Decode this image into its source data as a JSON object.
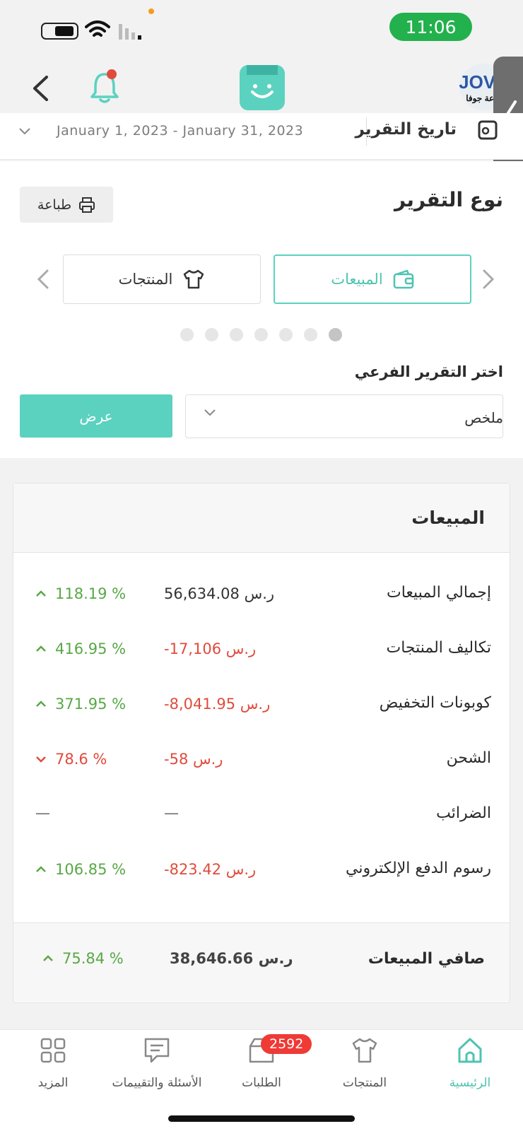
{
  "status": {
    "time": "11:06"
  },
  "brand": {
    "name": "JOVA",
    "sub": "مزرعة جوفا"
  },
  "report_date": {
    "label": "تاريخ التقرير",
    "range": "January 1, 2023 - January 31, 2023"
  },
  "report_type": {
    "title": "نوع التقرير",
    "print_label": "طباعة",
    "tiles": [
      {
        "label": "المبيعات",
        "icon": "wallet-icon",
        "selected": true
      },
      {
        "label": "المنتجات",
        "icon": "tshirt-icon",
        "selected": false
      }
    ],
    "page_dots": 7,
    "active_dot": 6
  },
  "sub_report": {
    "label": "اختر التقرير الفرعي",
    "selected": "ملخص",
    "button": "عرض"
  },
  "sales": {
    "title": "المبيعات",
    "rows": [
      {
        "label": "إجمالي المبيعات",
        "value": "56,634.08 ر.س",
        "value_tone": "neutral",
        "pct": "118.19 %",
        "trend": "up"
      },
      {
        "label": "تكاليف المنتجات",
        "value": "-17,106 ر.س",
        "value_tone": "neg",
        "pct": "416.95 %",
        "trend": "up"
      },
      {
        "label": "كوبونات التخفيض",
        "value": "-8,041.95 ر.س",
        "value_tone": "neg",
        "pct": "371.95 %",
        "trend": "up"
      },
      {
        "label": "الشحن",
        "value": "-58 ر.س",
        "value_tone": "neg",
        "pct": "78.6 %",
        "trend": "down"
      },
      {
        "label": "الضرائب",
        "value": "—",
        "value_tone": "dash",
        "pct": "—",
        "trend": "none"
      },
      {
        "label": "رسوم الدفع الإلكتروني",
        "value": "-823.42 ر.س",
        "value_tone": "neg",
        "pct": "106.85 %",
        "trend": "up"
      }
    ],
    "total": {
      "label": "صافي المبيعات",
      "value": "38,646.66 ر.س",
      "pct": "75.84 %",
      "trend": "up"
    }
  },
  "nav": {
    "items": [
      {
        "label": "الرئيسية",
        "icon": "home-icon",
        "active": true
      },
      {
        "label": "المنتجات",
        "icon": "tshirt-icon",
        "active": false
      },
      {
        "label": "الطلبات",
        "icon": "box-icon",
        "active": false
      },
      {
        "label": "الأسئلة والتقييمات",
        "icon": "chat-icon",
        "active": false
      },
      {
        "label": "المزيد",
        "icon": "grid-icon",
        "active": false
      }
    ],
    "orders_badge": "2592"
  },
  "colors": {
    "accent": "#5bd2bf",
    "positive": "#58a846",
    "negative": "#e04b3c",
    "badge": "#ef3a35",
    "status_pill": "#22b14c"
  }
}
